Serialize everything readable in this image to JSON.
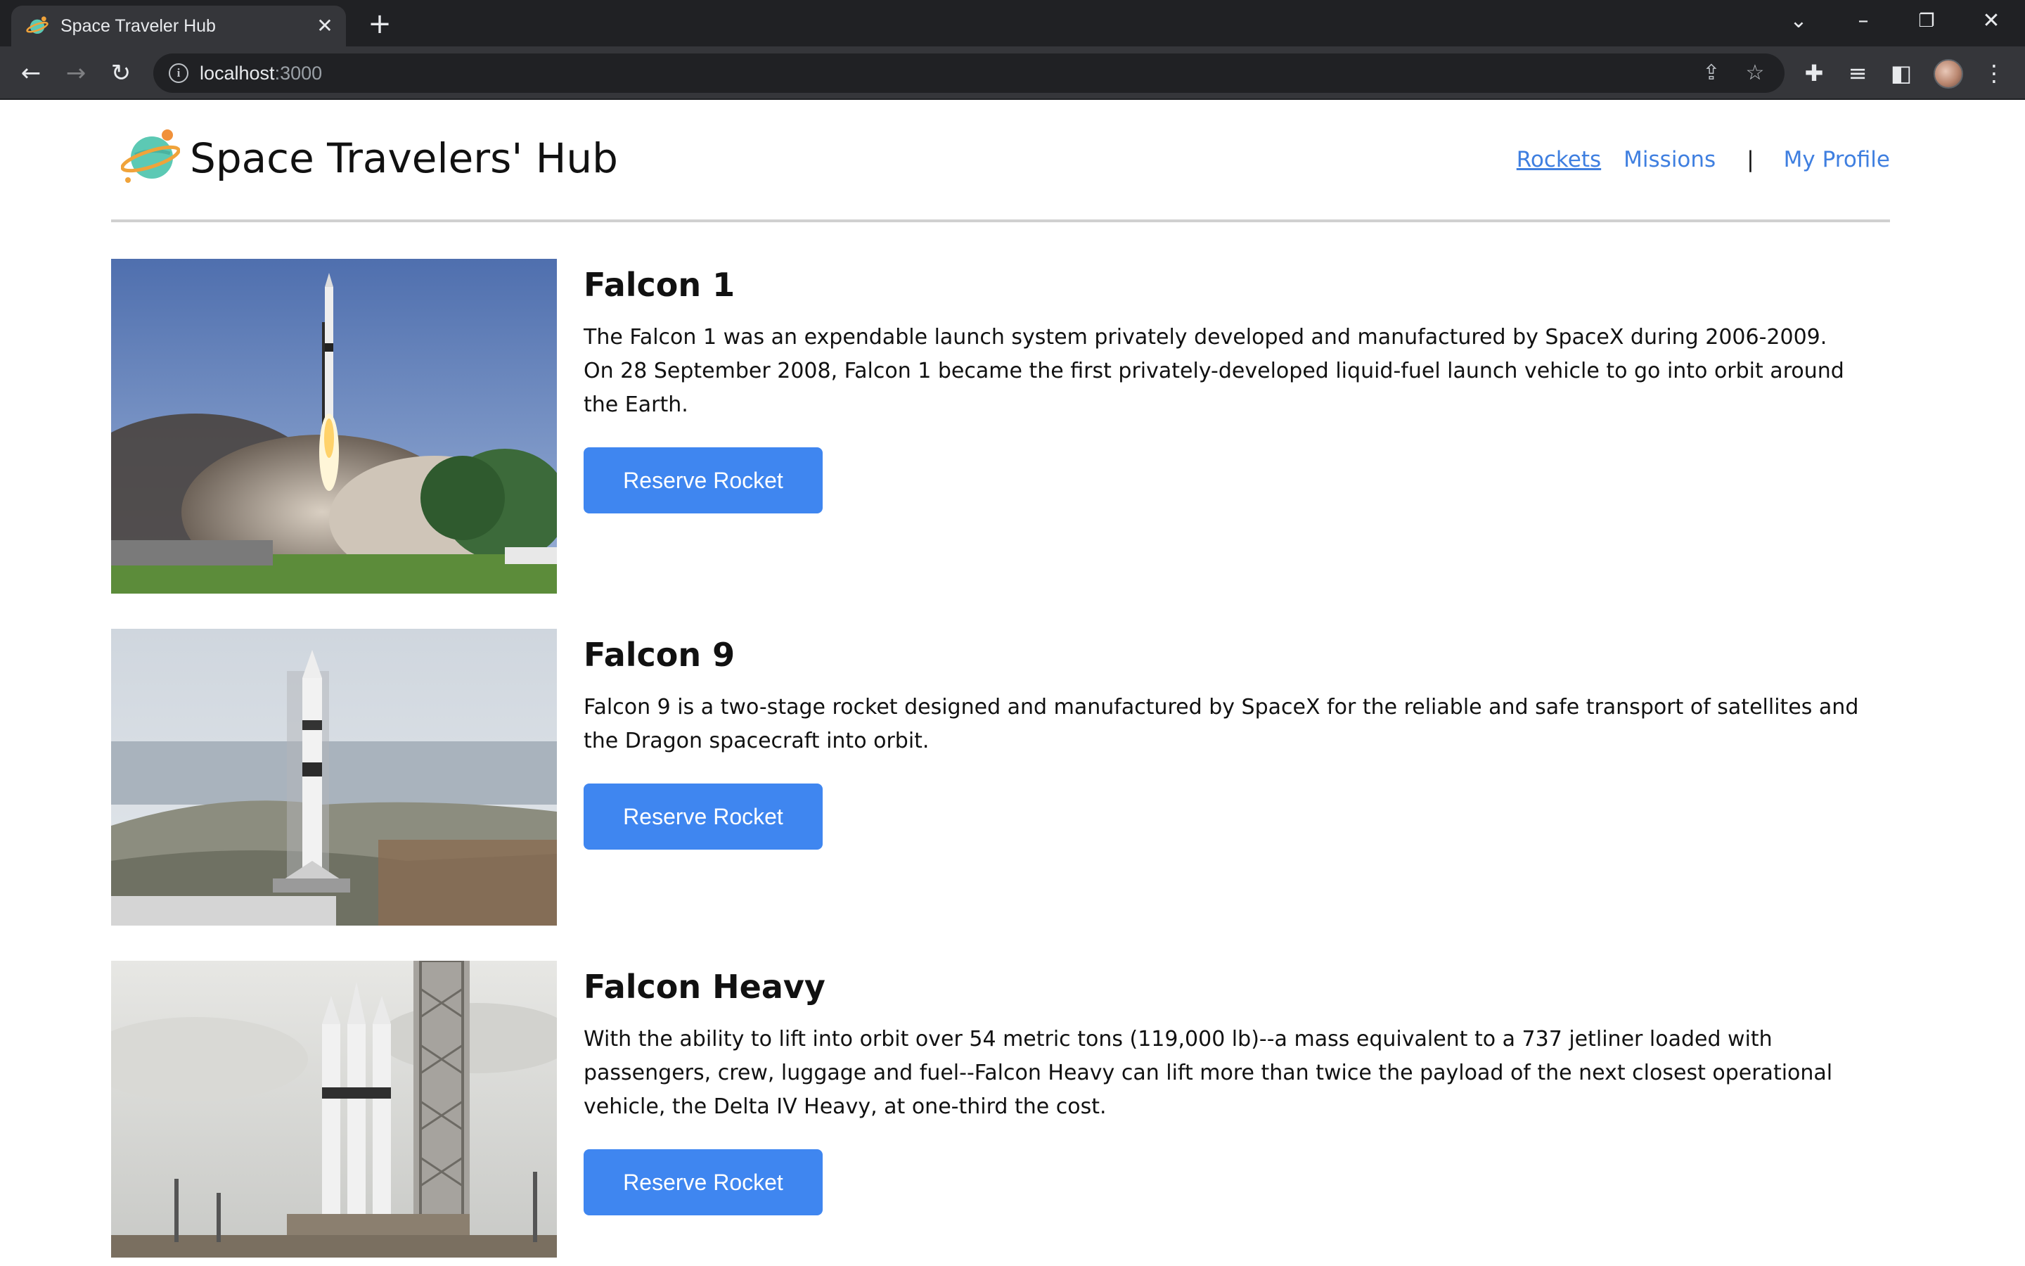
{
  "browser": {
    "tab_title": "Space Traveler Hub",
    "url_host": "localhost",
    "url_port": ":3000"
  },
  "site": {
    "title": "Space Travelers' Hub",
    "nav": {
      "rockets": "Rockets",
      "missions": "Missions",
      "separator": "|",
      "profile": "My Profile"
    }
  },
  "rockets": [
    {
      "name": "Falcon 1",
      "description": "The Falcon 1 was an expendable launch system privately developed and manufactured by SpaceX during 2006-2009. On 28 September 2008, Falcon 1 became the first privately-developed liquid-fuel launch vehicle to go into orbit around the Earth.",
      "button": "Reserve Rocket"
    },
    {
      "name": "Falcon 9",
      "description": "Falcon 9 is a two-stage rocket designed and manufactured by SpaceX for the reliable and safe transport of satellites and the Dragon spacecraft into orbit.",
      "button": "Reserve Rocket"
    },
    {
      "name": "Falcon Heavy",
      "description": "With the ability to lift into orbit over 54 metric tons (119,000 lb)--a mass equivalent to a 737 jetliner loaded with passengers, crew, luggage and fuel--Falcon Heavy can lift more than twice the payload of the next closest operational vehicle, the Delta IV Heavy, at one-third the cost.",
      "button": "Reserve Rocket"
    }
  ],
  "colors": {
    "accent": "#3f86f0",
    "link": "#3f7fe0",
    "chrome_dark": "#202124",
    "chrome_toolbar": "#35363a"
  },
  "icons": {
    "favicon": "planet-icon",
    "logo": "planet-logo-icon"
  }
}
